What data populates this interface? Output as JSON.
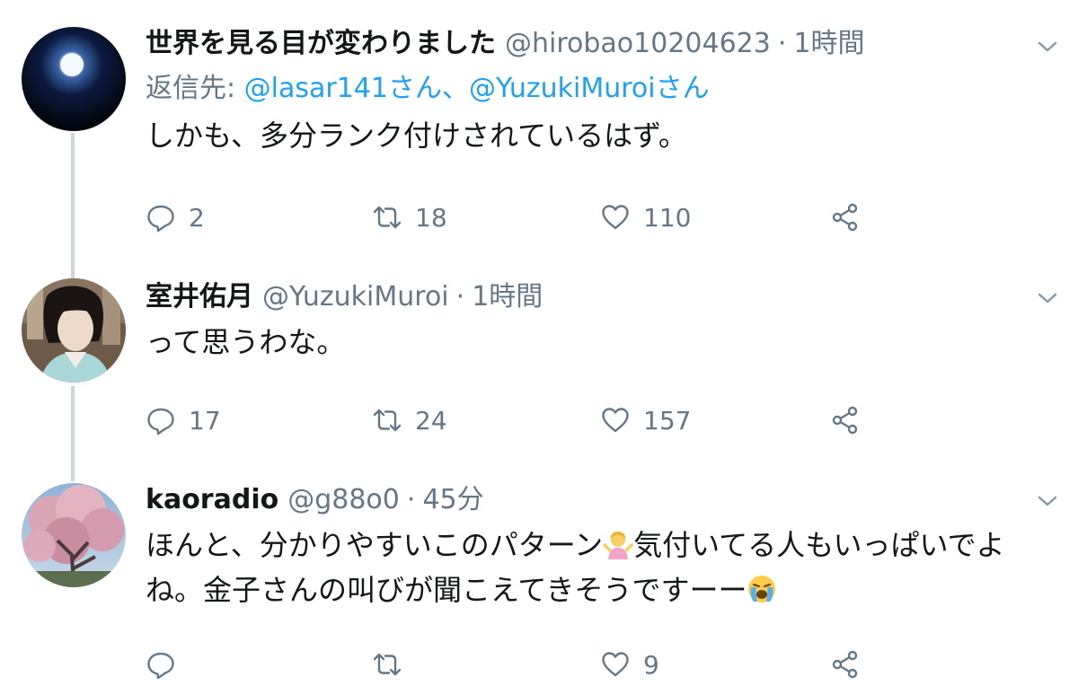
{
  "tweets": [
    {
      "name": "世界を見る目が変わりました",
      "handle": "@hirobao10204623",
      "separator": "·",
      "time": "1時間",
      "reply_prefix": "返信先: ",
      "reply_mentions": "@lasar141さん、@YuzukiMuroiさん",
      "text": "しかも、多分ランク付けされているはず。",
      "replies": "2",
      "retweets": "18",
      "likes": "110",
      "avatar": "moon-avatar"
    },
    {
      "name": "室井佑月",
      "handle": "@YuzukiMuroi",
      "separator": "·",
      "time": "1時間",
      "text": "って思うわな。",
      "replies": "17",
      "retweets": "24",
      "likes": "157",
      "avatar": "woman-portrait-avatar"
    },
    {
      "name": "kaoradio",
      "handle": "@g88o0",
      "separator": "·",
      "time": "45分",
      "text_part1": "ほんと、分かりやすいこのパターン",
      "text_part2": "気付いてる人もいっぱいでよね。金子さんの叫びが聞こえてきそうですーー",
      "emoji1": "person-shrugging-emoji",
      "emoji2": "loudly-crying-face-emoji",
      "replies": "",
      "retweets": "",
      "likes": "9",
      "avatar": "cherry-blossom-avatar"
    }
  ],
  "colors": {
    "text": "#14171a",
    "secondary": "#657786",
    "link": "#1da1f2",
    "thread_line": "#ccd6dd"
  }
}
